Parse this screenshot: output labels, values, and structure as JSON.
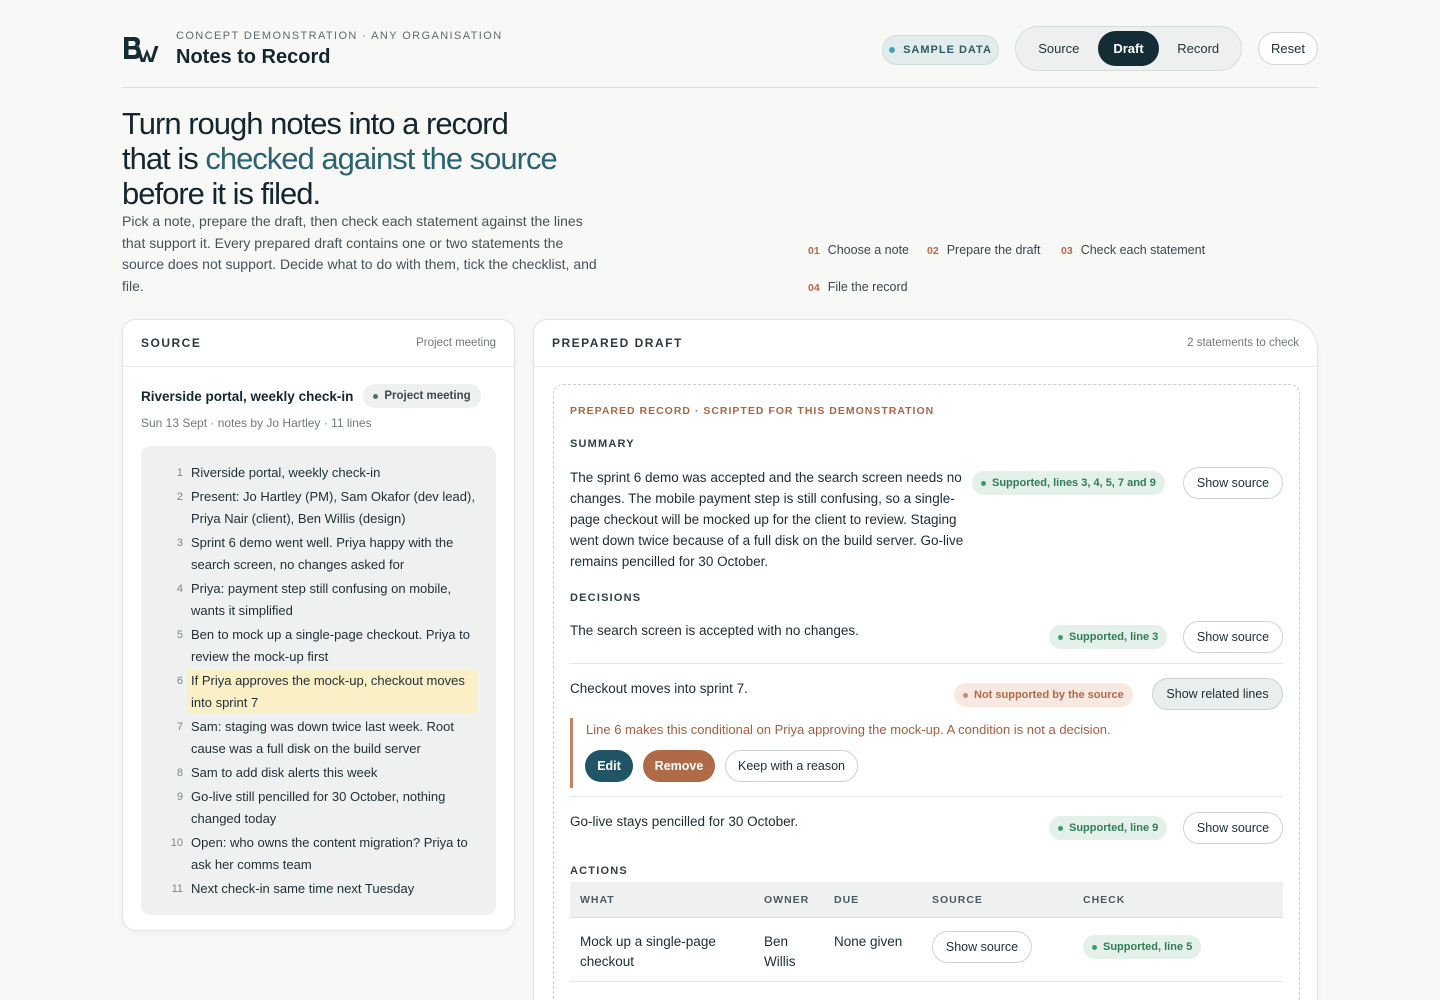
{
  "header": {
    "kicker": "CONCEPT DEMONSTRATION · ANY ORGANISATION",
    "title": "Notes to Record",
    "sample_label": "SAMPLE DATA",
    "views": [
      "Source",
      "Draft",
      "Record"
    ],
    "active_view": "Draft",
    "reset_label": "Reset"
  },
  "hero": {
    "title_a": "Turn rough notes into a record that is ",
    "title_accent": "checked against the source",
    "title_b": " before it is filed.",
    "body": "Pick a note, prepare the draft, then check each statement against the lines that support it. Every prepared draft contains one or two statements the source does not support. Decide what to do with them, tick the checklist, and file.",
    "steps": [
      {
        "num": "01",
        "label": "Choose a note"
      },
      {
        "num": "02",
        "label": "Prepare the draft"
      },
      {
        "num": "03",
        "label": "Check each statement"
      },
      {
        "num": "04",
        "label": "File the record"
      }
    ]
  },
  "source": {
    "panel_title": "SOURCE",
    "panel_meta": "Project meeting",
    "note_title": "Riverside portal, weekly check-in",
    "note_type": "Project meeting",
    "note_meta": "Sun 13 Sept · notes by Jo Hartley · 11 lines",
    "lines": [
      {
        "n": "1",
        "text": "Riverside portal, weekly check-in"
      },
      {
        "n": "2",
        "text": "Present: Jo Hartley (PM), Sam Okafor (dev lead), Priya Nair (client), Ben Willis (design)"
      },
      {
        "n": "3",
        "text": "Sprint 6 demo went well. Priya happy with the search screen, no changes asked for"
      },
      {
        "n": "4",
        "text": "Priya: payment step still confusing on mobile, wants it simplified"
      },
      {
        "n": "5",
        "text": "Ben to mock up a single-page checkout. Priya to review the mock-up first"
      },
      {
        "n": "6",
        "text": "If Priya approves the mock-up, checkout moves into sprint 7"
      },
      {
        "n": "7",
        "text": "Sam: staging was down twice last week. Root cause was a full disk on the build server"
      },
      {
        "n": "8",
        "text": "Sam to add disk alerts this week"
      },
      {
        "n": "9",
        "text": "Go-live still pencilled for 30 October, nothing changed today"
      },
      {
        "n": "10",
        "text": "Open: who owns the content migration? Priya to ask her comms team"
      },
      {
        "n": "11",
        "text": "Next check-in same time next Tuesday"
      }
    ],
    "highlighted_line": "6"
  },
  "draft": {
    "panel_title": "PREPARED DRAFT",
    "panel_meta": "2 statements to check",
    "kicker": "PREPARED RECORD · SCRIPTED FOR THIS DEMONSTRATION",
    "summary_label": "SUMMARY",
    "summary_text": "The sprint 6 demo was accepted and the search screen needs no changes. The mobile payment step is still confusing, so a single-page checkout will be mocked up for the client to review. Staging went down twice because of a full disk on the build server. Go-live remains pencilled for 30 October.",
    "summary_badge": "Supported, lines 3, 4, 5, 7 and 9",
    "show_source": "Show source",
    "decisions_label": "DECISIONS",
    "decisions": [
      {
        "text": "The search screen is accepted with no changes.",
        "badge": "Supported, line 3",
        "button": "Show source"
      },
      {
        "text": "Checkout moves into sprint 7.",
        "badge": "Not supported by the source",
        "button": "Show related lines"
      },
      {
        "text": "Go-live stays pencilled for 30 October.",
        "badge": "Supported, line 9",
        "button": "Show source"
      }
    ],
    "warning": "Line 6 makes this conditional on Priya approving the mock-up. A condition is not a decision.",
    "edit_label": "Edit",
    "remove_label": "Remove",
    "keep_label": "Keep with a reason",
    "actions_label": "ACTIONS",
    "actions_columns": [
      "WHAT",
      "OWNER",
      "DUE",
      "SOURCE",
      "CHECK"
    ],
    "actions_rows": [
      {
        "what": "Mock up a single-page checkout",
        "owner": "Ben Willis",
        "due": "None given",
        "source": "Show source",
        "check": "Supported, line 5"
      }
    ]
  },
  "colors": {
    "accent": "#2b6370",
    "dark": "#132c36",
    "supported": "#2f7d55",
    "unsupported": "#b06a48",
    "highlight": "#fbefc6"
  }
}
